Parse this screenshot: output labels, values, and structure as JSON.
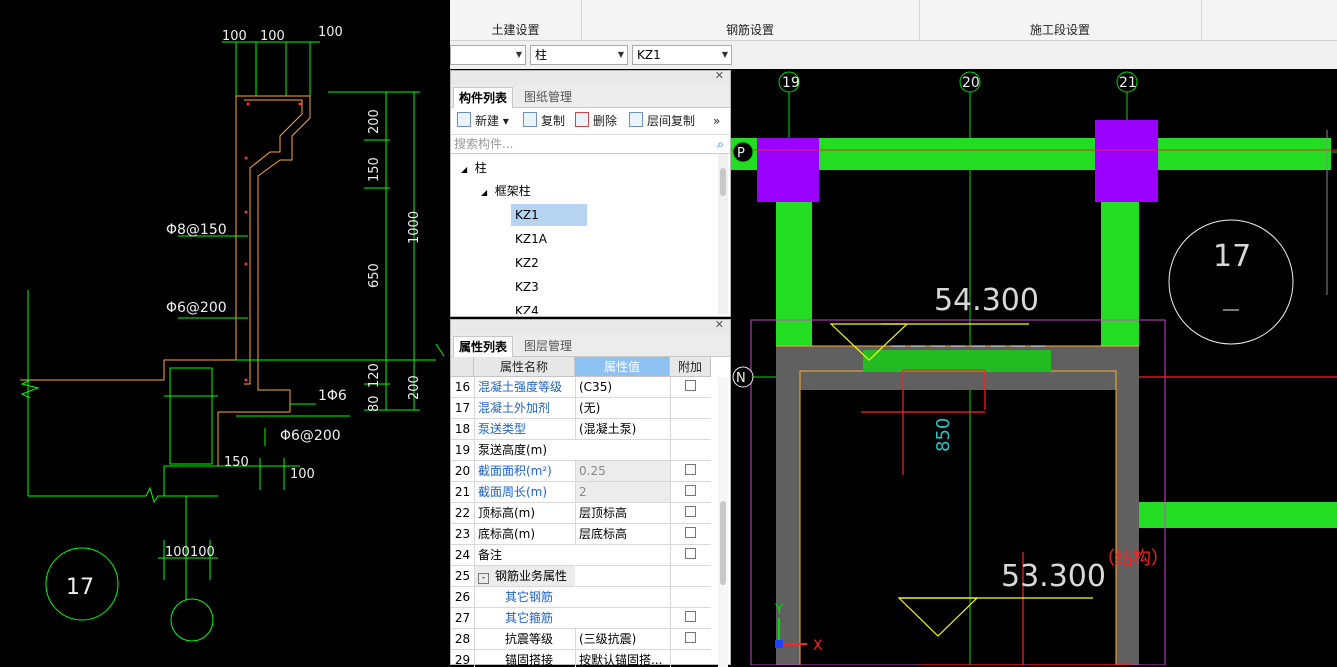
{
  "ribbon": {
    "groups": [
      "土建设置",
      "钢筋设置",
      "施工段设置"
    ]
  },
  "selectors": {
    "floor_value": "",
    "type_value": "柱",
    "component_value": "KZ1"
  },
  "component_panel": {
    "tabs": [
      "构件列表",
      "图纸管理"
    ],
    "toolbar": {
      "new": "新建",
      "copy": "复制",
      "delete": "删除",
      "floor_copy": "层间复制",
      "more": "»"
    },
    "search_placeholder": "搜索构件...",
    "tree": {
      "root": "柱",
      "group": "框架柱",
      "items": [
        "KZ1",
        "KZ1A",
        "KZ2",
        "KZ3",
        "KZ4"
      ],
      "selected": "KZ1"
    }
  },
  "property_panel": {
    "tabs": [
      "属性列表",
      "图层管理"
    ],
    "headers": {
      "name": "属性名称",
      "value": "属性值",
      "extra": "附加"
    },
    "rows": [
      {
        "num": "16",
        "name": "混凝土强度等级",
        "value": "(C35)",
        "blue": true,
        "check": true,
        "gray": false
      },
      {
        "num": "17",
        "name": "混凝土外加剂",
        "value": "(无)",
        "blue": true,
        "check": false,
        "gray": false
      },
      {
        "num": "18",
        "name": "泵送类型",
        "value": "(混凝土泵)",
        "blue": true,
        "check": false,
        "gray": false
      },
      {
        "num": "19",
        "name": "泵送高度(m)",
        "value": "",
        "blue": false,
        "check": false,
        "gray": false
      },
      {
        "num": "20",
        "name": "截面面积(m²)",
        "value": "0.25",
        "blue": true,
        "check": true,
        "gray": true
      },
      {
        "num": "21",
        "name": "截面周长(m)",
        "value": "2",
        "blue": true,
        "check": true,
        "gray": true
      },
      {
        "num": "22",
        "name": "顶标高(m)",
        "value": "层顶标高",
        "blue": false,
        "check": true,
        "gray": false
      },
      {
        "num": "23",
        "name": "底标高(m)",
        "value": "层底标高",
        "blue": false,
        "check": true,
        "gray": false
      },
      {
        "num": "24",
        "name": "备注",
        "value": "",
        "blue": false,
        "check": true,
        "gray": false
      },
      {
        "num": "25",
        "name": "钢筋业务属性",
        "value": "",
        "blue": false,
        "check": false,
        "gray": false
      },
      {
        "num": "26",
        "name": "其它钢筋",
        "value": "",
        "blue": true,
        "check": false,
        "gray": false
      },
      {
        "num": "27",
        "name": "其它箍筋",
        "value": "",
        "blue": true,
        "check": true,
        "gray": false
      },
      {
        "num": "28",
        "name": "抗震等级",
        "value": "(三级抗震)",
        "blue": false,
        "check": true,
        "gray": false
      },
      {
        "num": "29",
        "name": "锚固搭接",
        "value": "按默认锚固搭...",
        "blue": false,
        "check": false,
        "gray": false
      }
    ]
  },
  "left_drawing": {
    "dims_top": [
      "100",
      "100",
      "100"
    ],
    "dims_right": [
      "200",
      "150",
      "650",
      "120",
      "80",
      "1000",
      "200"
    ],
    "rebar_labels": [
      "Φ8@150",
      "Φ6@200",
      "1Φ6",
      "Φ6@200"
    ],
    "dims_bottom": [
      "150",
      "100",
      "100",
      "100"
    ],
    "detail_number": "17"
  },
  "right_drawing": {
    "axis_labels": [
      "19",
      "20",
      "21",
      "P",
      "N"
    ],
    "elevation_top": "54.300",
    "elevation_bottom": "53.300",
    "dim_850": "850",
    "structure_label": "（结构）",
    "detail_number": "17",
    "ucs_x": "X",
    "ucs_y": "Y"
  },
  "colors": {
    "beam_green": "#22dd22",
    "column_purple": "#9900ff",
    "wall_gray": "#606060",
    "cad_yellow": "#ffaa33",
    "cad_red": "#ff2020",
    "line_green": "#00ff00"
  }
}
